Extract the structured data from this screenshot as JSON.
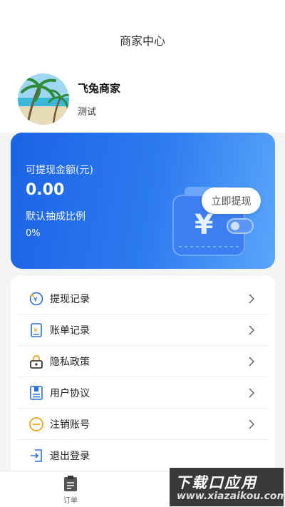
{
  "header": {
    "title": "商家中心"
  },
  "profile": {
    "name": "飞兔商家",
    "subtitle": "测试"
  },
  "wallet": {
    "balance_label": "可提现金额(元)",
    "balance": "0.00",
    "rate_label": "默认抽成比例",
    "rate": "0%",
    "withdraw_label": "立即提现"
  },
  "menu": {
    "items": [
      {
        "label": "提现记录",
        "icon": "withdraw-record-icon"
      },
      {
        "label": "账单记录",
        "icon": "bill-icon"
      },
      {
        "label": "隐私政策",
        "icon": "lock-icon"
      },
      {
        "label": "用户协议",
        "icon": "agreement-icon"
      },
      {
        "label": "注销账号",
        "icon": "minus-circle-icon"
      },
      {
        "label": "退出登录",
        "icon": "logout-icon"
      }
    ]
  },
  "tabbar": {
    "items": [
      {
        "label": "订单",
        "icon": "clipboard-icon"
      }
    ]
  },
  "watermark": {
    "main": "下载口应用",
    "sub": "www.xiazaikou.com"
  },
  "colors": {
    "accent": "#1b63e6",
    "card_gradient_end": "#5aa6fb",
    "icon_blue": "#2a6fdc",
    "icon_orange": "#f2a51a"
  }
}
